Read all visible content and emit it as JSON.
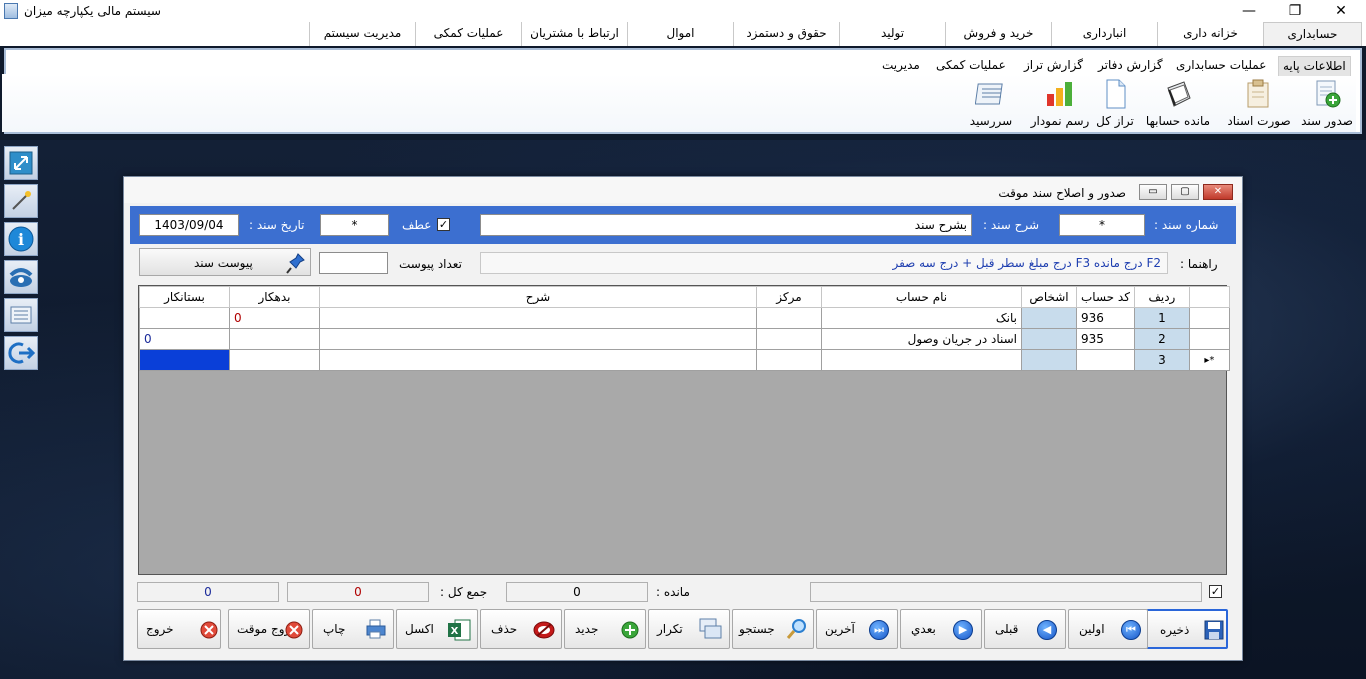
{
  "window": {
    "title": "سیستم مالی یکپارچه میزان",
    "minimize": "—",
    "restore": "❐",
    "close": "✕"
  },
  "menu_tabs": [
    "حسابداری",
    "خزانه داری",
    "انبارداری",
    "خرید و فروش",
    "تولید",
    "حقوق و دستمزد",
    "اموال",
    "ارتباط با مشتریان",
    "عملیات کمکی",
    "مدیریت سیستم"
  ],
  "ribbon": {
    "tabs": [
      "اطلاعات پایه",
      "عملیات حسابداری",
      "گزارش دفاتر",
      "گزارش تراز",
      "عملیات کمکی",
      "مدیریت"
    ],
    "buttons": [
      {
        "label": "صدور سند",
        "icon": "add-document-icon"
      },
      {
        "label": "صورت اسناد",
        "icon": "documents-list-icon"
      },
      {
        "label": "مانده حسابها",
        "icon": "notebook-icon"
      },
      {
        "label": "تراز کل",
        "icon": "blank-document-icon"
      },
      {
        "label": "رسم نمودار",
        "icon": "bar-chart-icon"
      },
      {
        "label": "سررسید",
        "icon": "calendar-book-icon"
      }
    ]
  },
  "left_toolbar": [
    "resize-icon",
    "magic-wand-icon",
    "info-icon",
    "phone-icon",
    "document-stack-icon",
    "logout-icon"
  ],
  "form": {
    "title": "صدور و اصلاح سند موقت",
    "doc_number_label": "شماره سند :",
    "doc_number_value": "*",
    "doc_desc_label": "شرح سند :",
    "doc_desc_value": "بشرح سند",
    "atf_label": "عطف",
    "atf_checked": true,
    "atf_value": "*",
    "doc_date_label": "تاریخ سند :",
    "doc_date_value": "1403/09/04",
    "guide_label": "راهنما :",
    "guide_text": "F2 درج مانده F3 درج مبلغ سطر قبل + درج سه صفر",
    "attach_count_label": "تعداد پیوست",
    "attach_count_value": "",
    "attach_button": "پیوست سند"
  },
  "grid": {
    "columns": [
      "ردیف",
      "کد حساب",
      "اشخاص",
      "نام حساب",
      "مرکز",
      "شرح",
      "بدهکار",
      "بستانکار"
    ],
    "rows": [
      {
        "row": "1",
        "code": "936",
        "person": "",
        "name": "بانک",
        "center": "",
        "desc": "",
        "debit": "0",
        "credit": ""
      },
      {
        "row": "2",
        "code": "935",
        "person": "",
        "name": "اسناد در جریان وصول",
        "center": "",
        "desc": "",
        "debit": "",
        "credit": "0"
      },
      {
        "row": "3",
        "code": "",
        "person": "",
        "name": "",
        "center": "",
        "desc": "",
        "debit": "",
        "credit": ""
      }
    ],
    "new_row_marker": "*"
  },
  "totals": {
    "balance_label": "مانده :",
    "balance_value": "0",
    "sum_label": "جمع کل :",
    "sum_debit": "0",
    "sum_credit": "0",
    "check_checked": true
  },
  "buttons": [
    {
      "label": "ذخیره",
      "icon": "save-icon"
    },
    {
      "label": "اولین",
      "icon": "first-icon"
    },
    {
      "label": "قبلی",
      "icon": "previous-icon"
    },
    {
      "label": "بعدي",
      "icon": "next-icon"
    },
    {
      "label": "آخرین",
      "icon": "last-icon"
    },
    {
      "label": "جستجو",
      "icon": "search-icon"
    },
    {
      "label": "تکرار",
      "icon": "copy-icon"
    },
    {
      "label": "جدید",
      "icon": "add-icon"
    },
    {
      "label": "حذف",
      "icon": "delete-icon"
    },
    {
      "label": "اکسل",
      "icon": "excel-icon"
    },
    {
      "label": "چاپ",
      "icon": "print-icon"
    },
    {
      "label": "خروج موقت",
      "icon": "temp-exit-icon"
    },
    {
      "label": "خروج",
      "icon": "exit-icon"
    }
  ],
  "colors": {
    "header_blue": "#3c6fd0",
    "selected_cell": "#0a3fd8",
    "shade_cell": "#c8dcec"
  }
}
